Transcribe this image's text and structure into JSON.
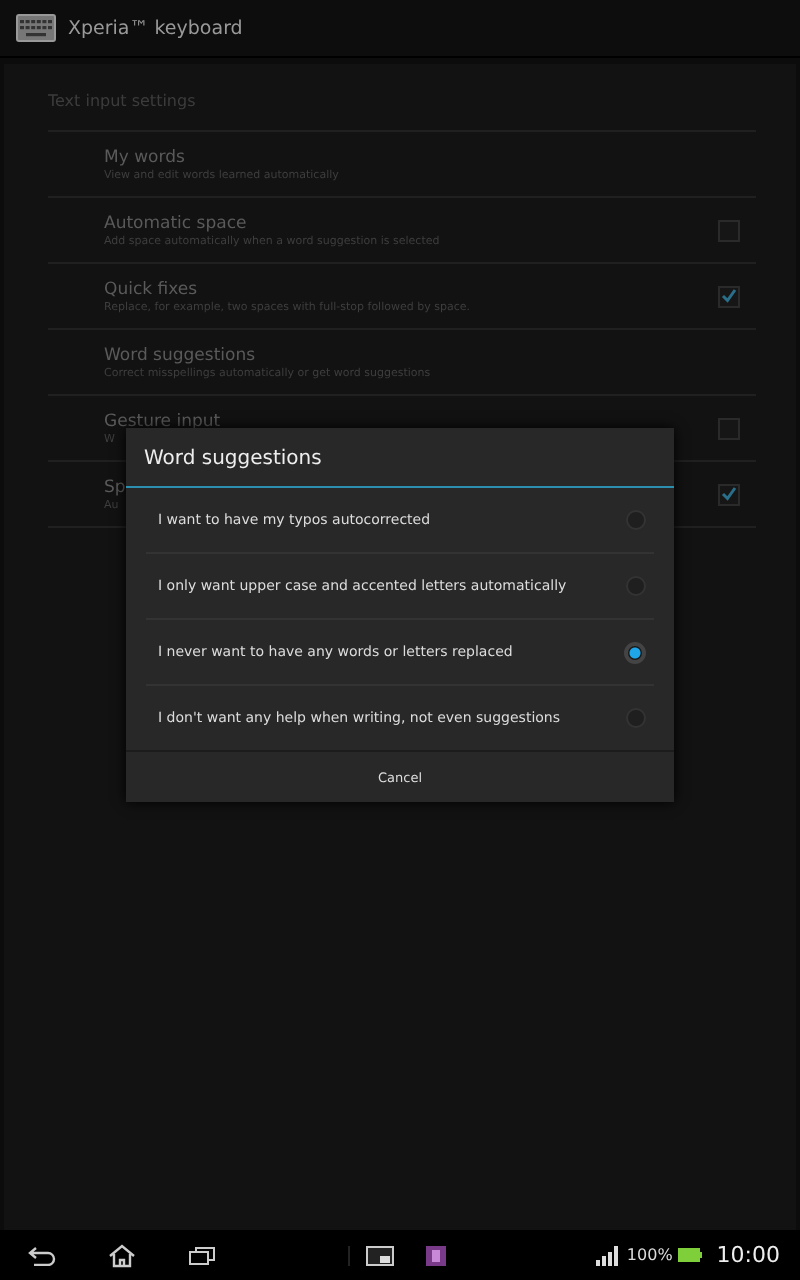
{
  "action_bar": {
    "title": "Xperia™ keyboard"
  },
  "settings": {
    "header": "Text input settings",
    "items": [
      {
        "kind": "link",
        "title": "My words",
        "subtitle": "View and edit words learned automatically"
      },
      {
        "kind": "checkbox",
        "title": "Automatic space",
        "subtitle": "Add space automatically when a word suggestion is selected",
        "checked": false
      },
      {
        "kind": "checkbox",
        "title": "Quick fixes",
        "subtitle": "Replace, for example, two spaces with full-stop followed by space.",
        "checked": true
      },
      {
        "kind": "link",
        "title": "Word suggestions",
        "subtitle": "Correct misspellings automatically or get word suggestions"
      },
      {
        "kind": "checkbox",
        "title": "Gesture input",
        "subtitle": "W",
        "checked": false
      },
      {
        "kind": "checkbox",
        "title": "Sp",
        "subtitle": "Au",
        "checked": true
      }
    ]
  },
  "dialog": {
    "title": "Word suggestions",
    "options": [
      {
        "label": "I want to have my typos autocorrected",
        "selected": false
      },
      {
        "label": "I only want upper case and accented letters automatically",
        "selected": false
      },
      {
        "label": "I never want to have any words or letters replaced",
        "selected": true
      },
      {
        "label": "I don't want any help when writing, not even suggestions",
        "selected": false
      }
    ],
    "cancel": "Cancel"
  },
  "nav_bar": {
    "battery": "100%",
    "time": "10:00"
  }
}
